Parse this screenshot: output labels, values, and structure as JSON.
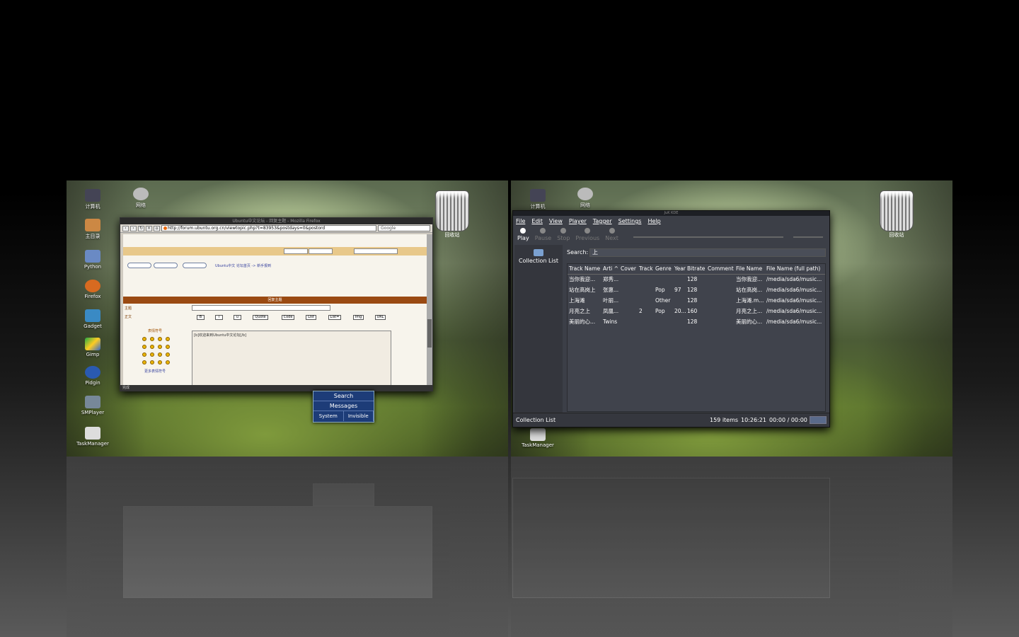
{
  "left_workspace": {
    "desktop_icons": [
      {
        "name": "computer-icon",
        "label": "计算机"
      },
      {
        "name": "folder-icon",
        "label": "主目录"
      },
      {
        "name": "python-icon",
        "label": "Python"
      },
      {
        "name": "firefox-icon",
        "label": "Firefox"
      },
      {
        "name": "gadget-icon",
        "label": "Gadget"
      },
      {
        "name": "gimp-icon",
        "label": "Gimp"
      },
      {
        "name": "pidgin-icon",
        "label": "Pidgin"
      },
      {
        "name": "smplayer-icon",
        "label": "SMPlayer"
      },
      {
        "name": "taskmanager-icon",
        "label": "TaskManager"
      }
    ],
    "network_icon_label": "网络",
    "trash_label": "回收站",
    "firefox": {
      "title": "Ubuntu中文论坛 - 回复主题 - Mozilla Firefox",
      "url": "http://forum.ubuntu.org.cn/viewtopic.php?t=83953&postdays=0&postord",
      "search_engine": "Google",
      "page_title": "回复主题",
      "subject_label": "主题",
      "body_label": "正文",
      "smilies_label": "表情符号",
      "more_smilies": "更多表情符号",
      "forum_links": "Ubuntu中文 论坛首页 -> 新手报到",
      "format_buttons": [
        "B",
        "i",
        "u",
        "Quote",
        "Code",
        "List",
        "List=",
        "Img",
        "URL"
      ],
      "body_text": "[b]欢迎来到Ubuntu中文论坛[/b]",
      "status": "完成"
    },
    "panel": {
      "search": "Search",
      "messages": "Messages",
      "system": "System",
      "invisible": "Invisible"
    }
  },
  "right_workspace": {
    "network_icon_label": "网络",
    "trash_label": "回收站",
    "computer_label": "计算机",
    "taskmanager_label": "TaskManager",
    "juk": {
      "title": "JuK KDE",
      "menu": [
        "File",
        "Edit",
        "View",
        "Player",
        "Tagger",
        "Settings",
        "Help"
      ],
      "toolbar": {
        "play": "Play",
        "pause": "Pause",
        "stop": "Stop",
        "previous": "Previous",
        "next": "Next"
      },
      "sidebar_label": "Collection List",
      "search_label": "Search:",
      "search_value": "上",
      "columns": [
        "Track Name",
        "Arti ^",
        "Cover",
        "Track",
        "Genre",
        "Year",
        "Bitrate",
        "Comment",
        "File Name",
        "File Name (full path)"
      ],
      "rows": [
        [
          "当你我迎...",
          "郑秀...",
          "",
          "",
          "",
          "",
          "128",
          "",
          "当你我迎...",
          "/media/sda6/music..."
        ],
        [
          "站在高岗上",
          "张惠...",
          "",
          "",
          "Pop",
          "97",
          "128",
          "",
          "站在高岗...",
          "/media/sda6/music..."
        ],
        [
          "上海滩",
          "叶丽...",
          "",
          "",
          "Other",
          "",
          "128",
          "",
          "上海滩.m...",
          "/media/sda6/music..."
        ],
        [
          "月亮之上",
          "凤凰...",
          "",
          "2",
          "Pop",
          "20...",
          "160",
          "",
          "月亮之上...",
          "/media/sda6/music..."
        ],
        [
          "美丽的心...",
          "Twins",
          "",
          "",
          "",
          "",
          "128",
          "",
          "美丽的心...",
          "/media/sda6/music..."
        ]
      ],
      "status_left": "Collection List",
      "item_count": "159 items",
      "total_time": "10:26:21",
      "position": "00:00 / 00:00"
    }
  }
}
